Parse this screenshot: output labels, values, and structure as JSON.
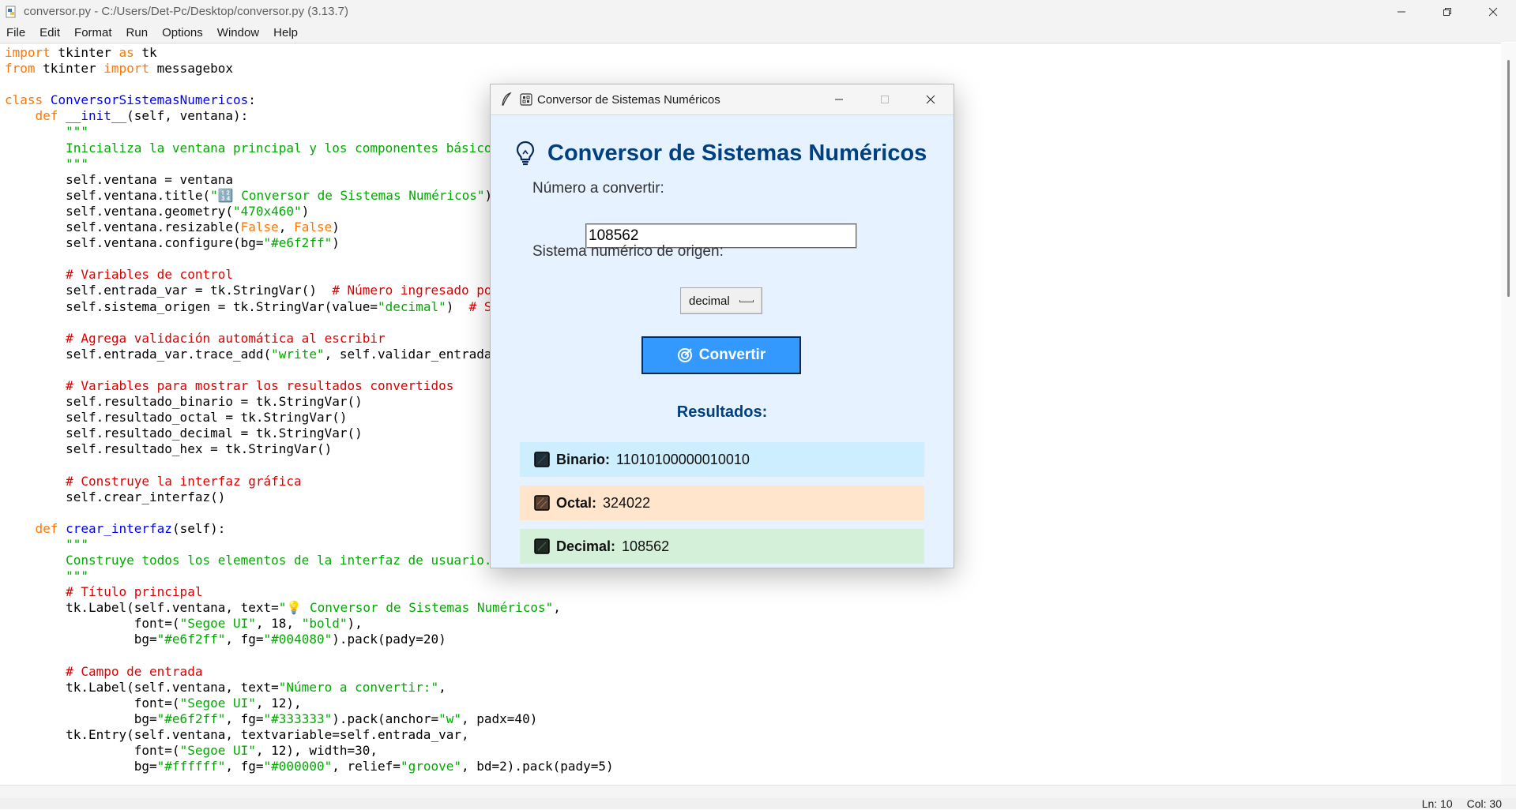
{
  "idle": {
    "title": "conversor.py - C:/Users/Det-Pc/Desktop/conversor.py (3.13.7)",
    "menu": [
      "File",
      "Edit",
      "Format",
      "Run",
      "Options",
      "Window",
      "Help"
    ],
    "status": {
      "line": "Ln: 10",
      "col": "Col: 30"
    }
  },
  "code_lines": [
    [
      [
        "kw",
        "import"
      ],
      [
        "t",
        " tkinter "
      ],
      [
        "kw",
        "as"
      ],
      [
        "t",
        " tk"
      ]
    ],
    [
      [
        "kw",
        "from"
      ],
      [
        "t",
        " tkinter "
      ],
      [
        "kw",
        "import"
      ],
      [
        "t",
        " messagebox"
      ]
    ],
    [],
    [
      [
        "kw",
        "class"
      ],
      [
        "t",
        " "
      ],
      [
        "def",
        "ConversorSistemasNumericos"
      ],
      [
        "t",
        ":"
      ]
    ],
    [
      [
        "t",
        "    "
      ],
      [
        "kw",
        "def"
      ],
      [
        "t",
        " "
      ],
      [
        "def",
        "__init__"
      ],
      [
        "t",
        "(self, ventana):"
      ]
    ],
    [
      [
        "t",
        "        "
      ],
      [
        "str",
        "\"\"\""
      ]
    ],
    [
      [
        "t",
        "        "
      ],
      [
        "str",
        "Inicializa la ventana principal y los componentes básicos."
      ]
    ],
    [
      [
        "t",
        "        "
      ],
      [
        "str",
        "\"\"\""
      ]
    ],
    [
      [
        "t",
        "        self.ventana = ventana"
      ]
    ],
    [
      [
        "t",
        "        self.ventana.title("
      ],
      [
        "str",
        "\"🔢 Conversor de Sistemas Numéricos\""
      ],
      [
        "t",
        ")"
      ]
    ],
    [
      [
        "t",
        "        self.ventana.geometry("
      ],
      [
        "str",
        "\"470x460\""
      ],
      [
        "t",
        ")"
      ]
    ],
    [
      [
        "t",
        "        self.ventana.resizable("
      ],
      [
        "kw",
        "False"
      ],
      [
        "t",
        ", "
      ],
      [
        "kw",
        "False"
      ],
      [
        "t",
        ")"
      ]
    ],
    [
      [
        "t",
        "        self.ventana.configure(bg="
      ],
      [
        "str",
        "\"#e6f2ff\""
      ],
      [
        "t",
        ")"
      ]
    ],
    [],
    [
      [
        "t",
        "        "
      ],
      [
        "cmt",
        "# Variables de control"
      ]
    ],
    [
      [
        "t",
        "        self.entrada_var = tk.StringVar()  "
      ],
      [
        "cmt",
        "# Número ingresado por el usuario"
      ]
    ],
    [
      [
        "t",
        "        self.sistema_origen = tk.StringVar(value="
      ],
      [
        "str",
        "\"decimal\""
      ],
      [
        "t",
        ")  "
      ],
      [
        "cmt",
        "# Sistema de origen"
      ]
    ],
    [],
    [
      [
        "t",
        "        "
      ],
      [
        "cmt",
        "# Agrega validación automática al escribir"
      ]
    ],
    [
      [
        "t",
        "        self.entrada_var.trace_add("
      ],
      [
        "str",
        "\"write\""
      ],
      [
        "t",
        ", self.validar_entrada)"
      ]
    ],
    [],
    [
      [
        "t",
        "        "
      ],
      [
        "cmt",
        "# Variables para mostrar los resultados convertidos"
      ]
    ],
    [
      [
        "t",
        "        self.resultado_binario = tk.StringVar()"
      ]
    ],
    [
      [
        "t",
        "        self.resultado_octal = tk.StringVar()"
      ]
    ],
    [
      [
        "t",
        "        self.resultado_decimal = tk.StringVar()"
      ]
    ],
    [
      [
        "t",
        "        self.resultado_hex = tk.StringVar()"
      ]
    ],
    [],
    [
      [
        "t",
        "        "
      ],
      [
        "cmt",
        "# Construye la interfaz gráfica"
      ]
    ],
    [
      [
        "t",
        "        self.crear_interfaz()"
      ]
    ],
    [],
    [
      [
        "t",
        "    "
      ],
      [
        "kw",
        "def"
      ],
      [
        "t",
        " "
      ],
      [
        "def",
        "crear_interfaz"
      ],
      [
        "t",
        "(self):"
      ]
    ],
    [
      [
        "t",
        "        "
      ],
      [
        "str",
        "\"\"\""
      ]
    ],
    [
      [
        "t",
        "        "
      ],
      [
        "str",
        "Construye todos los elementos de la interfaz de usuario."
      ]
    ],
    [
      [
        "t",
        "        "
      ],
      [
        "str",
        "\"\"\""
      ]
    ],
    [
      [
        "t",
        "        "
      ],
      [
        "cmt",
        "# Título principal"
      ]
    ],
    [
      [
        "t",
        "        tk.Label(self.ventana, text="
      ],
      [
        "str",
        "\"💡 Conversor de Sistemas Numéricos\""
      ],
      [
        "t",
        ","
      ]
    ],
    [
      [
        "t",
        "                 font=("
      ],
      [
        "str",
        "\"Segoe UI\""
      ],
      [
        "t",
        ", 18, "
      ],
      [
        "str",
        "\"bold\""
      ],
      [
        "t",
        "),"
      ]
    ],
    [
      [
        "t",
        "                 bg="
      ],
      [
        "str",
        "\"#e6f2ff\""
      ],
      [
        "t",
        ", fg="
      ],
      [
        "str",
        "\"#004080\""
      ],
      [
        "t",
        ").pack(pady=20)"
      ]
    ],
    [],
    [
      [
        "t",
        "        "
      ],
      [
        "cmt",
        "# Campo de entrada"
      ]
    ],
    [
      [
        "t",
        "        tk.Label(self.ventana, text="
      ],
      [
        "str",
        "\"Número a convertir:\""
      ],
      [
        "t",
        ","
      ]
    ],
    [
      [
        "t",
        "                 font=("
      ],
      [
        "str",
        "\"Segoe UI\""
      ],
      [
        "t",
        ", 12),"
      ]
    ],
    [
      [
        "t",
        "                 bg="
      ],
      [
        "str",
        "\"#e6f2ff\""
      ],
      [
        "t",
        ", fg="
      ],
      [
        "str",
        "\"#333333\""
      ],
      [
        "t",
        ").pack(anchor="
      ],
      [
        "str",
        "\"w\""
      ],
      [
        "t",
        ", padx=40)"
      ]
    ],
    [
      [
        "t",
        "        tk.Entry(self.ventana, textvariable=self.entrada_var,"
      ]
    ],
    [
      [
        "t",
        "                 font=("
      ],
      [
        "str",
        "\"Segoe UI\""
      ],
      [
        "t",
        ", 12), width=30,"
      ]
    ],
    [
      [
        "t",
        "                 bg="
      ],
      [
        "str",
        "\"#ffffff\""
      ],
      [
        "t",
        ", fg="
      ],
      [
        "str",
        "\"#000000\""
      ],
      [
        "t",
        ", relief="
      ],
      [
        "str",
        "\"groove\""
      ],
      [
        "t",
        ", bd=2).pack(pady=5)"
      ]
    ]
  ],
  "app": {
    "window_title": "Conversor de Sistemas Numéricos",
    "heading": "Conversor de Sistemas Numéricos",
    "input_label": "Número a convertir:",
    "input_value": "108562",
    "origin_label": "Sistema numérico de origen:",
    "origin_value": "decimal",
    "convert_label": "Convertir",
    "results_title": "Resultados:",
    "results": [
      {
        "label": "Binario:",
        "value": "11010100000010010",
        "bg": "#cceeff"
      },
      {
        "label": "Octal:",
        "value": "324022",
        "bg": "#ffe5cc"
      },
      {
        "label": "Decimal:",
        "value": "108562",
        "bg": "#d5f0d8"
      }
    ]
  },
  "colors": {
    "app_bg": "#e6f2ff",
    "heading_fg": "#004080",
    "button_bg": "#3399ff",
    "keyword": "#ff7700",
    "definition": "#0000ff",
    "string": "#00aa00",
    "comment": "#dd0000"
  }
}
